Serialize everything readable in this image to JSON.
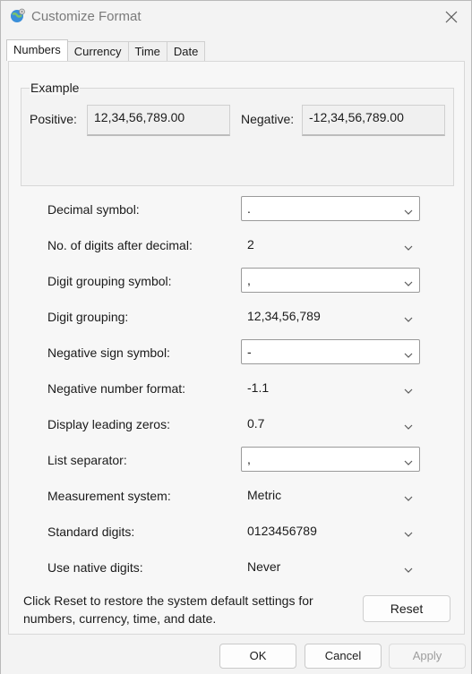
{
  "window": {
    "title": "Customize Format",
    "icon": "globe-settings-icon",
    "close_icon": "close-icon"
  },
  "tabs": [
    {
      "label": "Numbers",
      "active": true
    },
    {
      "label": "Currency",
      "active": false
    },
    {
      "label": "Time",
      "active": false
    },
    {
      "label": "Date",
      "active": false
    }
  ],
  "example": {
    "legend": "Example",
    "positive_label": "Positive:",
    "positive_value": "12,34,56,789.00",
    "negative_label": "Negative:",
    "negative_value": "-12,34,56,789.00"
  },
  "settings": [
    {
      "label": "Decimal symbol:",
      "value": ".",
      "editable": true
    },
    {
      "label": "No. of digits after decimal:",
      "value": "2",
      "editable": false
    },
    {
      "label": "Digit grouping symbol:",
      "value": ",",
      "editable": true
    },
    {
      "label": "Digit grouping:",
      "value": "12,34,56,789",
      "editable": false
    },
    {
      "label": "Negative sign symbol:",
      "value": "-",
      "editable": true
    },
    {
      "label": "Negative number format:",
      "value": "-1.1",
      "editable": false
    },
    {
      "label": "Display leading zeros:",
      "value": "0.7",
      "editable": false
    },
    {
      "label": "List separator:",
      "value": ",",
      "editable": true
    },
    {
      "label": "Measurement system:",
      "value": "Metric",
      "editable": false
    },
    {
      "label": "Standard digits:",
      "value": "0123456789",
      "editable": false
    },
    {
      "label": "Use native digits:",
      "value": "Never",
      "editable": false
    }
  ],
  "reset": {
    "description": "Click Reset to restore the system default settings for numbers, currency, time, and date.",
    "button_label": "Reset"
  },
  "footer": {
    "ok_label": "OK",
    "cancel_label": "Cancel",
    "apply_label": "Apply"
  }
}
